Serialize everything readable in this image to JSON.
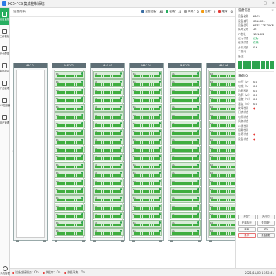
{
  "app": {
    "title": "KCS-FCS 集成控制系统",
    "window_buttons": [
      "—",
      "□",
      "×"
    ]
  },
  "sidebar": {
    "items": [
      {
        "label": "设备监控",
        "icon": "monitor-icon",
        "active": true
      },
      {
        "label": "工作看板",
        "icon": "dashboard-icon",
        "active": false
      },
      {
        "label": "安全配置",
        "icon": "shield-icon",
        "active": false
      },
      {
        "label": "数据报表",
        "icon": "report-icon",
        "active": false
      },
      {
        "label": "产品管理",
        "icon": "box-icon",
        "active": false
      },
      {
        "label": "FCS控制器",
        "icon": "controller-icon",
        "active": false
      },
      {
        "label": "用户管理",
        "icon": "user-icon",
        "active": false
      }
    ],
    "bottom_label": "系统管理"
  },
  "topbar": {
    "tab": "设备列表",
    "stats": [
      {
        "label": "全部设备：",
        "value": "48",
        "color": "#3a6ea5"
      },
      {
        "label": "在线：",
        "value": "48",
        "color": "#27ae60"
      },
      {
        "label": "离线：",
        "value": "0",
        "color": "#9e9e9e"
      },
      {
        "label": "告警：",
        "value": "0",
        "color": "#f39c12"
      },
      {
        "label": "故障：",
        "value": "0",
        "color": "#e53935"
      }
    ]
  },
  "racks": [
    {
      "name": "MAC 01",
      "empty": true,
      "devices": []
    },
    {
      "name": "MAC 02",
      "empty": false,
      "devices": [
        "KA",
        "KA",
        "KA",
        "KA",
        "KA",
        "KA",
        "KA",
        "KA",
        "KA",
        "KA",
        "KA",
        "KA",
        "KA",
        "KA",
        "KA",
        "KA",
        "KA",
        "KA",
        "KA",
        "KA"
      ]
    },
    {
      "name": "MAC 03",
      "empty": false,
      "devices": [
        "KA",
        "KA",
        "KA",
        "KA",
        "KA",
        "KA",
        "KA",
        "KA",
        "KA",
        "KA",
        "KA",
        "KA",
        "KA",
        "KA",
        "KA",
        "KA",
        "KA",
        "KA",
        "KA",
        "KA"
      ]
    },
    {
      "name": "MAC 04",
      "empty": false,
      "devices": [
        "KA",
        "KA",
        "KA",
        "KA",
        "KA",
        "KA",
        "KA",
        "KA",
        "KA",
        "KA",
        "KA",
        "KA",
        "KA",
        "KA",
        "KA",
        "KA",
        "KA",
        "KA",
        "KA",
        "KA"
      ]
    },
    {
      "name": "MAC 05",
      "empty": false,
      "devices": [
        "KA",
        "KA",
        "KA",
        "KA",
        "KA",
        "KA",
        "KA",
        "KA",
        "KA",
        "KA",
        "KA",
        "KA",
        "KA",
        "KA",
        "KA",
        "KA",
        "KA",
        "KA",
        "KA",
        "KA"
      ]
    },
    {
      "name": "MAC 06",
      "empty": false,
      "devices": [
        "KA",
        "KA",
        "KA",
        "KA",
        "KA",
        "KA",
        "KA",
        "KA",
        "KA",
        "KA",
        "KA",
        "KA",
        "KA",
        "KA",
        "KA",
        "KA",
        "KA",
        "KA",
        "KA",
        "KA"
      ]
    }
  ],
  "right_panel": {
    "title": "设备信息",
    "close": "×",
    "info": [
      {
        "k": "设备名称",
        "v": "KA02",
        "c": ""
      },
      {
        "k": "设备编号",
        "v": "0010001",
        "c": ""
      },
      {
        "k": "设备型号",
        "v": "KSZF-12F-20KN",
        "c": ""
      },
      {
        "k": "所属区域",
        "v": "A1",
        "c": ""
      },
      {
        "k": "IP地址",
        "v": "10.1.0.2",
        "c": ""
      },
      {
        "k": "运行状态",
        "v": "运行",
        "c": "green"
      },
      {
        "k": "在线状态",
        "v": "在线",
        "c": "green"
      },
      {
        "k": "开机时长",
        "v": "0 h",
        "c": ""
      },
      {
        "k": "二维码",
        "v": "",
        "c": ""
      },
      {
        "k": "备注",
        "v": "",
        "c": ""
      }
    ],
    "io_title": "设备IO",
    "io": [
      {
        "k": "电压（V）",
        "v": "0.0",
        "c": ""
      },
      {
        "k": "电流（A）",
        "v": "0.0",
        "c": ""
      },
      {
        "k": "功率因数",
        "v": "0.0",
        "c": ""
      },
      {
        "k": "功率（W）",
        "v": "0.0",
        "c": ""
      },
      {
        "k": "温度（℃）",
        "v": "0.0",
        "c": ""
      },
      {
        "k": "湿度（%）",
        "v": "0.0",
        "c": ""
      },
      {
        "k": "故障检测",
        "v": "●",
        "c": "red"
      },
      {
        "k": "门禁状态",
        "v": "",
        "c": ""
      },
      {
        "k": "电源状态",
        "v": "",
        "c": ""
      },
      {
        "k": "风扇状态",
        "v": "",
        "c": ""
      },
      {
        "k": "水浸检测",
        "v": "",
        "c": ""
      },
      {
        "k": "烟雾检测",
        "v": "",
        "c": ""
      },
      {
        "k": "告警状态",
        "v": "●",
        "c": "red"
      },
      {
        "k": "设备状态",
        "v": "●",
        "c": "red"
      }
    ],
    "buttons": [
      {
        "label": "开启门",
        "red": false
      },
      {
        "label": "关闭门",
        "red": false
      },
      {
        "label": "开机执行",
        "red": false
      },
      {
        "label": "关机执行",
        "red": false
      },
      {
        "label": "重启",
        "red": false
      },
      {
        "label": "复位",
        "red": false
      },
      {
        "label": "急停",
        "red": true
      },
      {
        "label": "设备参数",
        "red": false
      }
    ]
  },
  "statusbar": {
    "items": [
      "设备连接服务：On",
      "数据库：On",
      "数据采集：On"
    ],
    "time": "2021/11/08 16:53:41"
  }
}
